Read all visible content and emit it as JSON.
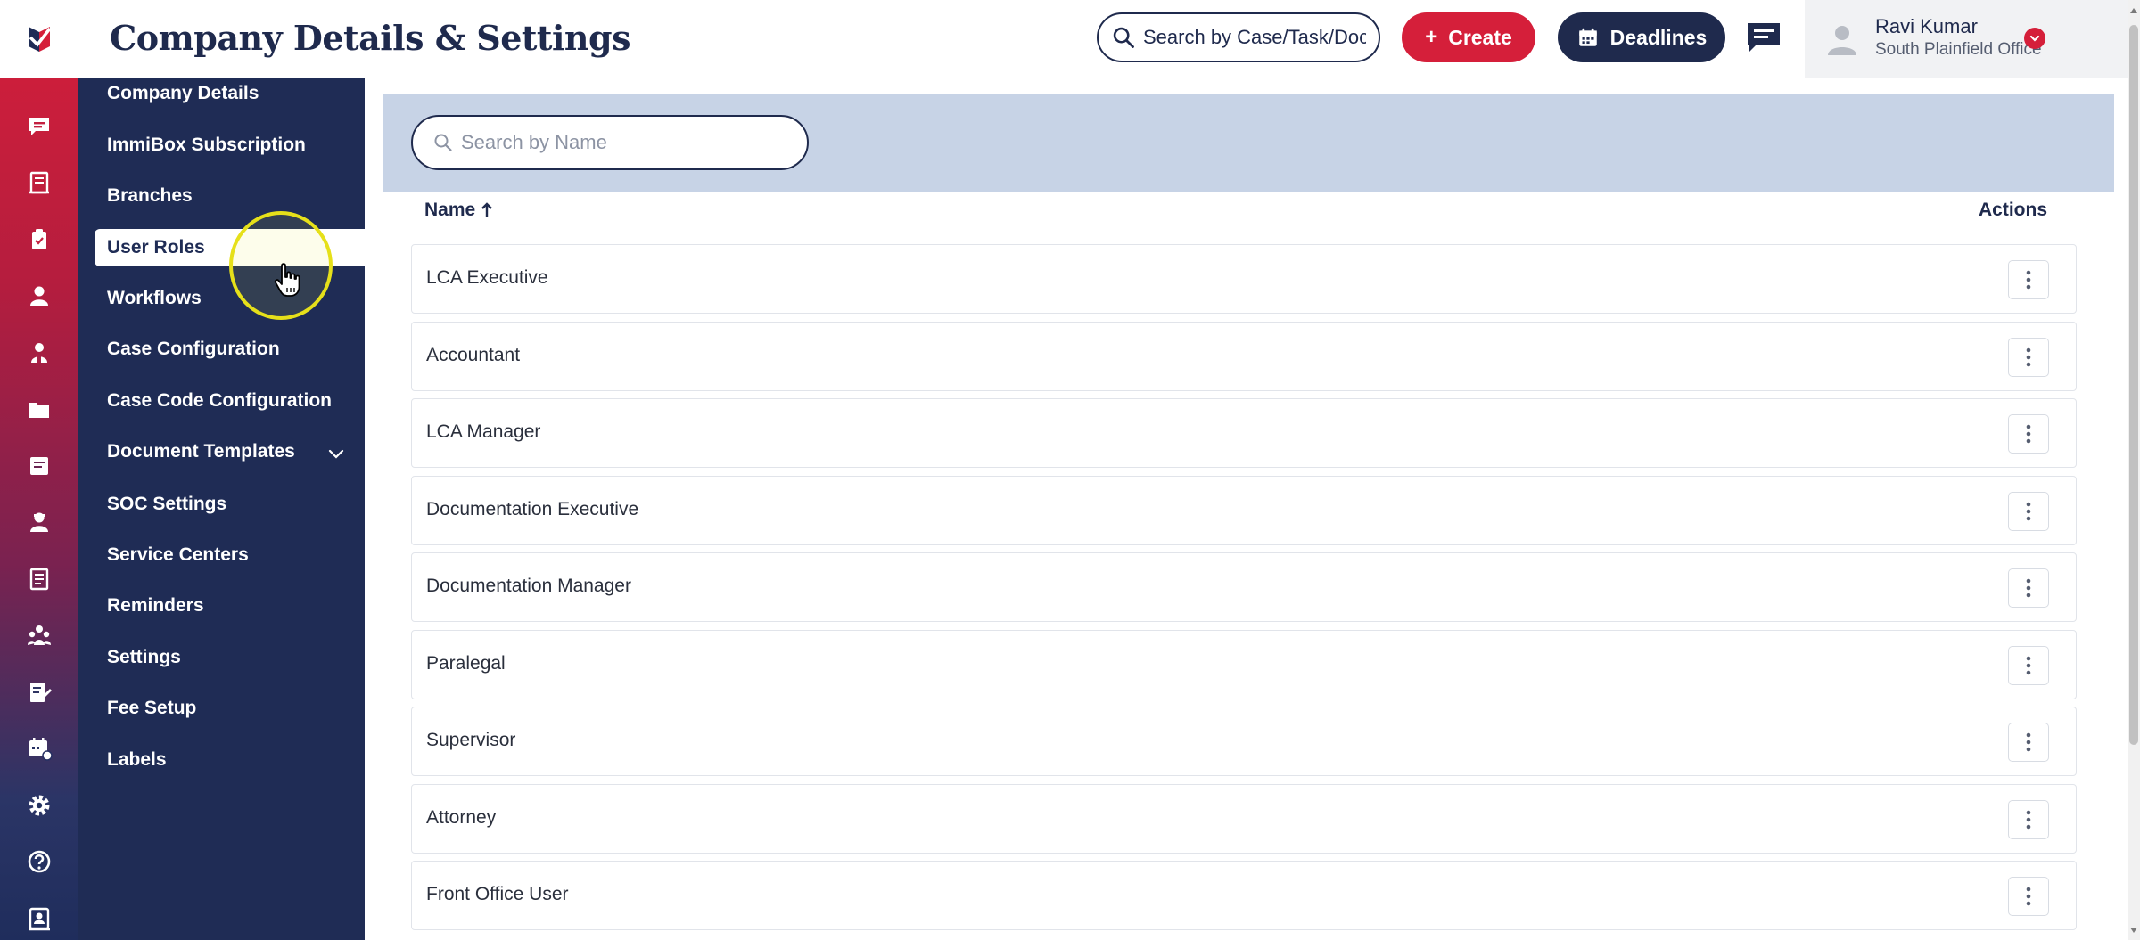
{
  "header": {
    "title": "Company Details & Settings",
    "search_placeholder": "Search by Case/Task/Document",
    "create_label": "Create",
    "deadlines_label": "Deadlines",
    "user": {
      "name": "Ravi Kumar",
      "office": "South Plainfield Office"
    }
  },
  "rail": {
    "icons": [
      "chat-icon",
      "book-icon",
      "clipboard-icon",
      "person-icon",
      "person-group-icon",
      "folder-icon",
      "note-icon",
      "agent-icon",
      "document-icon",
      "team-icon",
      "form-icon",
      "calendar-settings-icon",
      "gear-icon",
      "help-icon",
      "contacts-icon"
    ]
  },
  "settings_nav": {
    "items": [
      {
        "label": "Company Details"
      },
      {
        "label": "ImmiBox Subscription"
      },
      {
        "label": "Branches"
      },
      {
        "label": "User Roles",
        "active": true
      },
      {
        "label": "Workflows"
      },
      {
        "label": "Case Configuration"
      },
      {
        "label": "Case Code Configuration"
      },
      {
        "label": "Document Templates",
        "has_children": true
      },
      {
        "label": "SOC Settings"
      },
      {
        "label": "Service Centers"
      },
      {
        "label": "Reminders"
      },
      {
        "label": "Settings"
      },
      {
        "label": "Fee Setup"
      },
      {
        "label": "Labels"
      }
    ]
  },
  "roles_table": {
    "search_placeholder": "Search by Name",
    "columns": {
      "name": "Name",
      "actions": "Actions"
    },
    "sort": "ascending",
    "rows": [
      "LCA Executive",
      "Accountant",
      "LCA Manager",
      "Documentation Executive",
      "Documentation Manager",
      "Paralegal",
      "Supervisor",
      "Attorney",
      "Front Office User"
    ]
  },
  "colors": {
    "navy": "#1f2c55",
    "brand_red": "#d51f3a",
    "filter_bar": "#c7d3e6"
  }
}
